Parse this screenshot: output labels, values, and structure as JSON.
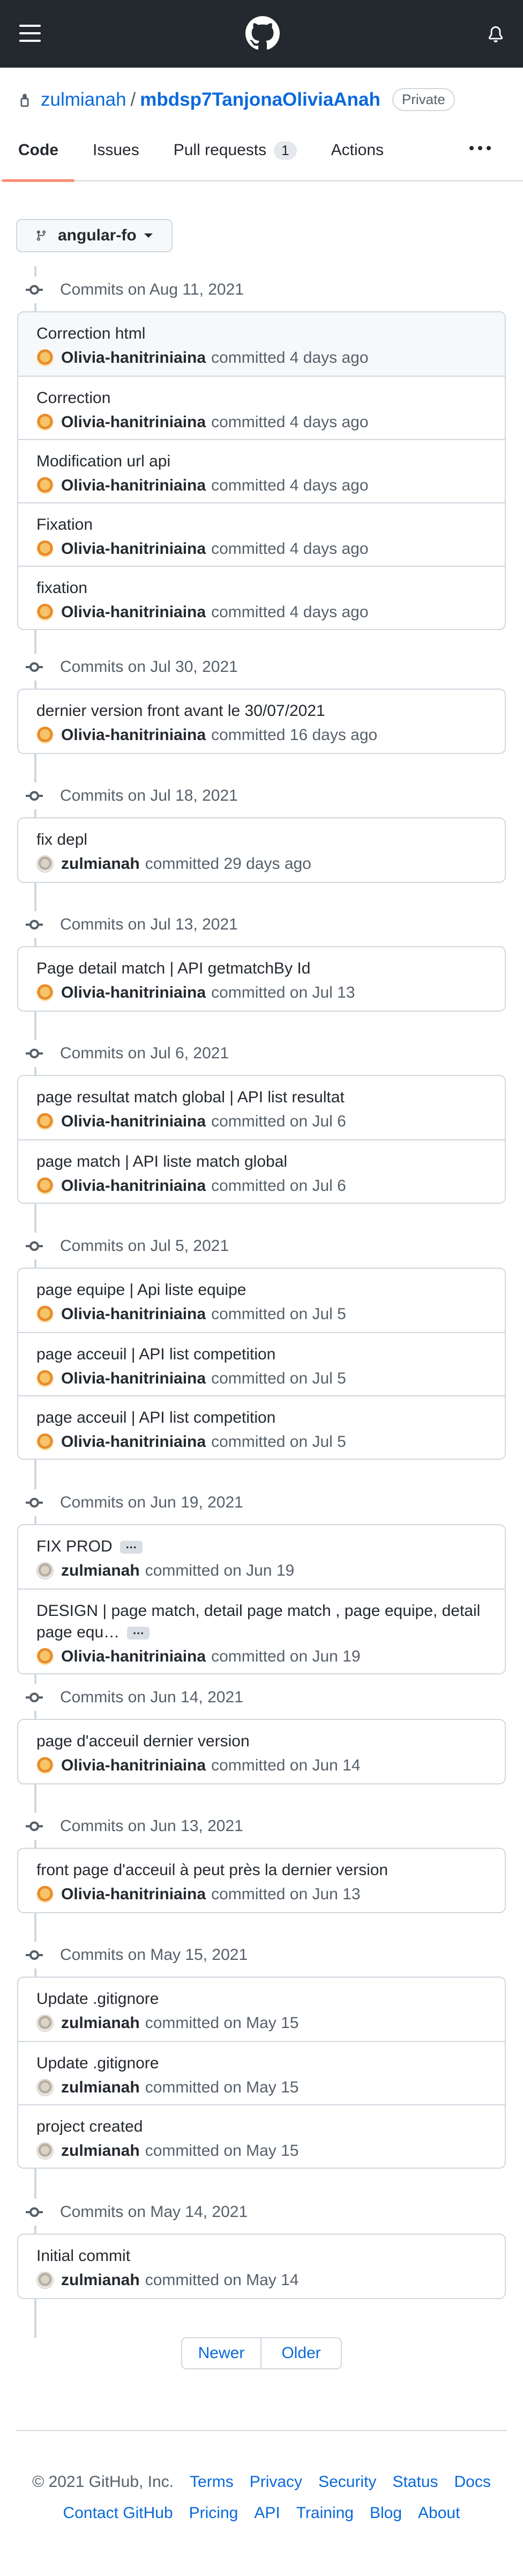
{
  "header": {
    "menu_icon": "hamburger-icon",
    "logo_icon": "github-logo-icon",
    "notifications_icon": "bell-icon"
  },
  "repo": {
    "owner": "zulmianah",
    "separator": "/",
    "name": "mbdsp7TanjonaOliviaAnah",
    "visibility": "Private"
  },
  "tabs": [
    {
      "label": "Code",
      "active": true
    },
    {
      "label": "Issues"
    },
    {
      "label": "Pull requests",
      "count": "1"
    },
    {
      "label": "Actions"
    }
  ],
  "branch": {
    "label": "angular-fo"
  },
  "groups": [
    {
      "date": "Commits on Aug 11, 2021",
      "commits": [
        {
          "message": "Correction html",
          "author": "Olivia-hanitriniaina",
          "time": "committed 4 days ago"
        },
        {
          "message": "Correction",
          "author": "Olivia-hanitriniaina",
          "time": "committed 4 days ago"
        },
        {
          "message": "Modification url api",
          "author": "Olivia-hanitriniaina",
          "time": "committed 4 days ago"
        },
        {
          "message": "Fixation",
          "author": "Olivia-hanitriniaina",
          "time": "committed 4 days ago"
        },
        {
          "message": "fixation",
          "author": "Olivia-hanitriniaina",
          "time": "committed 4 days ago"
        }
      ]
    },
    {
      "date": "Commits on Jul 30, 2021",
      "commits": [
        {
          "message": "dernier version front avant le 30/07/2021",
          "author": "Olivia-hanitriniaina",
          "time": "committed 16 days ago"
        }
      ]
    },
    {
      "date": "Commits on Jul 18, 2021",
      "commits": [
        {
          "message": "fix depl",
          "author": "zulmianah",
          "time": "committed 29 days ago"
        }
      ]
    },
    {
      "date": "Commits on Jul 13, 2021",
      "commits": [
        {
          "message": "Page detail match | API getmatchBy Id",
          "author": "Olivia-hanitriniaina",
          "time": "committed on Jul 13"
        }
      ]
    },
    {
      "date": "Commits on Jul 6, 2021",
      "commits": [
        {
          "message": "page resultat match global | API list resultat",
          "author": "Olivia-hanitriniaina",
          "time": "committed on Jul 6"
        },
        {
          "message": "page match | API liste match global",
          "author": "Olivia-hanitriniaina",
          "time": "committed on Jul 6"
        }
      ]
    },
    {
      "date": "Commits on Jul 5, 2021",
      "commits": [
        {
          "message": "page equipe | Api liste equipe",
          "author": "Olivia-hanitriniaina",
          "time": "committed on Jul 5"
        },
        {
          "message": "page acceuil | API list competition",
          "author": "Olivia-hanitriniaina",
          "time": "committed on Jul 5"
        },
        {
          "message": "page acceuil | API list competition",
          "author": "Olivia-hanitriniaina",
          "time": "committed on Jul 5"
        }
      ]
    },
    {
      "date": "Commits on Jun 19, 2021",
      "commits": [
        {
          "message": "FIX PROD",
          "author": "zulmianah",
          "time": "committed on Jun 19",
          "more": "…"
        },
        {
          "message": "DESIGN | page match, detail page match , page equipe, detail page equ…",
          "author": "Olivia-hanitriniaina",
          "time": "committed on Jun 19",
          "more": "…"
        }
      ]
    },
    {
      "date": "Commits on Jun 14, 2021",
      "commits": [
        {
          "message": "page d'acceuil dernier version",
          "author": "Olivia-hanitriniaina",
          "time": "committed on Jun 14"
        }
      ]
    },
    {
      "date": "Commits on Jun 13, 2021",
      "commits": [
        {
          "message": "front page d'acceuil à peut près la dernier version",
          "author": "Olivia-hanitriniaina",
          "time": "committed on Jun 13"
        }
      ]
    },
    {
      "date": "Commits on May 15, 2021",
      "commits": [
        {
          "message": "Update .gitignore",
          "author": "zulmianah",
          "time": "committed on May 15"
        },
        {
          "message": "Update .gitignore",
          "author": "zulmianah",
          "time": "committed on May 15"
        },
        {
          "message": "project created",
          "author": "zulmianah",
          "time": "committed on May 15"
        }
      ]
    },
    {
      "date": "Commits on May 14, 2021",
      "commits": [
        {
          "message": "Initial commit",
          "author": "zulmianah",
          "time": "committed on May 14"
        }
      ]
    }
  ],
  "pagination": {
    "newer": "Newer",
    "older": "Older"
  },
  "footer": {
    "copyright": "© 2021 GitHub, Inc.",
    "row1": [
      "Terms",
      "Privacy",
      "Security",
      "Status",
      "Docs"
    ],
    "row2": [
      "Contact GitHub",
      "Pricing",
      "API",
      "Training",
      "Blog",
      "About"
    ]
  }
}
